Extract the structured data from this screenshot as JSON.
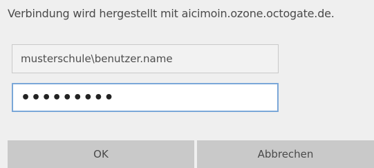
{
  "dialog": {
    "message": "Verbindung wird hergestellt mit aicimoin.ozone.octogate.de.",
    "username": "musterschule\\benutzer.name",
    "password_mask": "•••••••••",
    "ok_label": "OK",
    "cancel_label": "Abbrechen"
  },
  "colors": {
    "background": "#efefef",
    "button": "#c9c9c9",
    "focus_border": "#7aa7d8"
  }
}
